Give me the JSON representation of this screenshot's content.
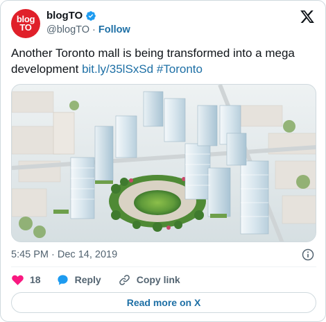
{
  "account": {
    "avatar_text_line1": "blog",
    "avatar_text_line2": "TO",
    "display_name": "blogTO",
    "handle": "@blogTO",
    "separator": "·",
    "follow_label": "Follow"
  },
  "tweet": {
    "text": "Another Toronto mall is being transformed into a mega development ",
    "link": "bit.ly/35lSxSd",
    "hashtag": "#Toronto"
  },
  "meta": {
    "timestamp": "5:45 PM · Dec 14, 2019"
  },
  "actions": {
    "like_count": "18",
    "reply_label": "Reply",
    "copy_link_label": "Copy link"
  },
  "footer": {
    "read_more_label": "Read more on X"
  },
  "colors": {
    "brand_red": "#e0202a",
    "link_blue": "#1d6fa5",
    "like_pink": "#f91880",
    "reply_blue": "#1d9bf0",
    "verified_blue": "#1d9bf0"
  },
  "icons": [
    "verified-badge-icon",
    "x-logo-icon",
    "info-icon",
    "heart-icon",
    "reply-bubble-icon",
    "link-icon"
  ]
}
